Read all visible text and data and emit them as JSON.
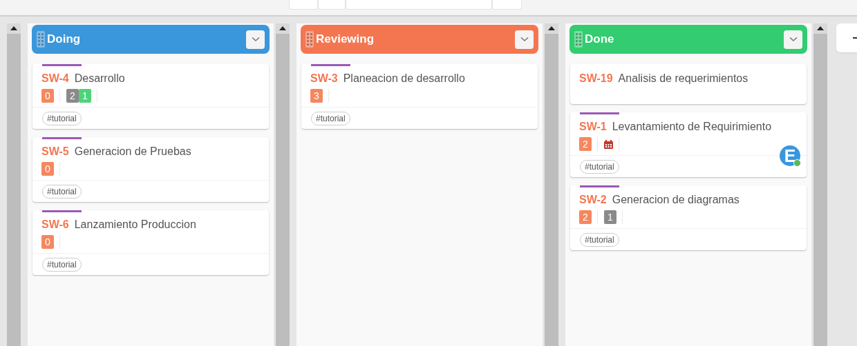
{
  "columns": [
    {
      "title": "Doing",
      "color": "#3a97dc",
      "cards": [
        {
          "key": "SW-4",
          "title": "Desarrollo",
          "color": "#9b59b6",
          "badges": [
            {
              "kind": "count",
              "text": "0"
            },
            {
              "kind": "gray",
              "text": "2"
            },
            {
              "kind": "green",
              "text": "1"
            }
          ],
          "tags": [
            "#tutorial"
          ]
        },
        {
          "key": "SW-5",
          "title": "Generacion de Pruebas",
          "color": "#9b59b6",
          "badges": [
            {
              "kind": "count",
              "text": "0"
            }
          ],
          "tags": [
            "#tutorial"
          ]
        },
        {
          "key": "SW-6",
          "title": "Lanzamiento Produccion",
          "color": "#9b59b6",
          "badges": [
            {
              "kind": "count",
              "text": "0"
            }
          ],
          "tags": [
            "#tutorial"
          ]
        }
      ]
    },
    {
      "title": "Reviewing",
      "color": "#f47650",
      "cards": [
        {
          "key": "SW-3",
          "title": "Planeacion de desarrollo",
          "color": "#9b59b6",
          "badges": [
            {
              "kind": "count",
              "text": "3"
            }
          ],
          "tags": [
            "#tutorial"
          ]
        }
      ]
    },
    {
      "title": "Done",
      "color": "#33cc70",
      "cards": [
        {
          "key": "SW-19",
          "title": "Analisis de requerimientos"
        },
        {
          "key": "SW-1",
          "title": "Levantamiento de Requirimiento",
          "color": "#9b59b6",
          "badges": [
            {
              "kind": "count",
              "text": "2"
            },
            {
              "kind": "calendar"
            }
          ],
          "avatar": {
            "initial": "E",
            "online": true
          },
          "tags": [
            "#tutorial"
          ]
        },
        {
          "key": "SW-2",
          "title": "Generacion de diagramas",
          "color": "#9b59b6",
          "badges": [
            {
              "kind": "count",
              "text": "2"
            },
            {
              "kind": "gray",
              "text": "1"
            }
          ],
          "tags": [
            "#tutorial"
          ]
        }
      ]
    }
  ]
}
